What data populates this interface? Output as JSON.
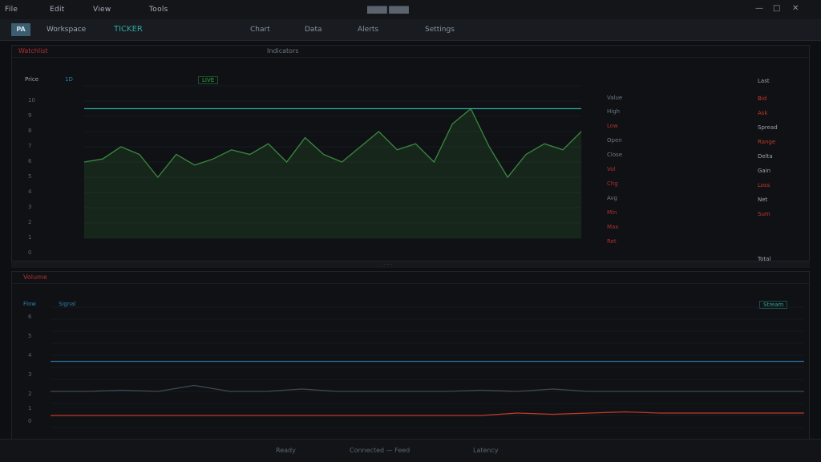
{
  "app": {
    "window_title": "████ ████",
    "menus": [
      "File",
      "Edit",
      "View",
      "Tools"
    ]
  },
  "window_controls": {
    "min": "—",
    "max": "□",
    "close": "✕"
  },
  "toolbar": {
    "logo": "PA",
    "name": "Workspace",
    "symbol": "TICKER",
    "buttons": [
      "Chart",
      "Data",
      "Alerts",
      "Settings"
    ]
  },
  "panel1": {
    "header_left": "Watchlist",
    "header_mid": "Indicators",
    "title": "Price",
    "subtitle": "1D",
    "badge": "LIVE",
    "right_header": "Value",
    "y_labels": [
      "10",
      "9",
      "8",
      "7",
      "6",
      "5",
      "4",
      "3",
      "2",
      "1",
      "0"
    ],
    "mid_labels": [
      "High",
      "Low",
      "Open",
      "Close",
      "Vol",
      "Chg",
      "Avg",
      "Min",
      "Max",
      "Ret"
    ],
    "right_labels": [
      "Last",
      "Bid",
      "Ask",
      "Spread",
      "Range",
      "Delta",
      "Gain",
      "Loss",
      "Net",
      "Sum",
      "Total"
    ]
  },
  "splitter": {
    "label": "· · ·"
  },
  "panel2": {
    "header_left": "Volume",
    "title": "Flow",
    "subtitle": "Signal",
    "badge": "Stream",
    "y_labels": [
      "6",
      "5",
      "4",
      "3",
      "2",
      "1",
      "0"
    ]
  },
  "statusbar": {
    "items": [
      "Ready",
      "Connected — Feed",
      "Latency"
    ]
  },
  "colors": {
    "accent": "#2fa8a0",
    "line_green": "#3b8a3e",
    "line_blue": "#2d6fa0",
    "line_red": "#c0392b",
    "bg": "#0d0f12"
  },
  "chart_data": [
    {
      "type": "line",
      "title": "",
      "series": [
        {
          "values": [
            0.5,
            0.52,
            0.6,
            0.55,
            0.4,
            0.55,
            0.48,
            0.52,
            0.58,
            0.55,
            0.62,
            0.5,
            0.66,
            0.55,
            0.5,
            0.6,
            0.7,
            0.58,
            0.62,
            0.5,
            0.75,
            0.85,
            0.6,
            0.4,
            0.55,
            0.62,
            0.58,
            0.7
          ]
        },
        {
          "values": [
            0.85,
            0.85,
            0.85,
            0.85,
            0.85,
            0.85,
            0.85,
            0.85,
            0.85,
            0.85,
            0.85,
            0.85,
            0.85,
            0.85,
            0.85,
            0.85,
            0.85,
            0.85,
            0.85,
            0.85,
            0.85,
            0.85,
            0.85,
            0.85,
            0.85,
            0.85,
            0.85,
            0.85
          ]
        }
      ]
    },
    {
      "type": "line",
      "title": "",
      "series": [
        {
          "values": [
            0.3,
            0.3,
            0.31,
            0.3,
            0.35,
            0.3,
            0.3,
            0.32,
            0.3,
            0.3,
            0.3,
            0.3,
            0.31,
            0.3,
            0.32,
            0.3,
            0.3,
            0.3,
            0.3,
            0.3,
            0.3,
            0.3
          ]
        },
        {
          "values": [
            0.55,
            0.55,
            0.55,
            0.55,
            0.55,
            0.55,
            0.55,
            0.55,
            0.55,
            0.55,
            0.55,
            0.55,
            0.55,
            0.55,
            0.55,
            0.55,
            0.55,
            0.55,
            0.55,
            0.55,
            0.55,
            0.55
          ]
        },
        {
          "values": [
            0.1,
            0.1,
            0.1,
            0.1,
            0.1,
            0.1,
            0.1,
            0.1,
            0.1,
            0.1,
            0.1,
            0.1,
            0.1,
            0.12,
            0.11,
            0.12,
            0.13,
            0.12,
            0.12,
            0.12,
            0.12,
            0.12
          ]
        }
      ]
    }
  ]
}
